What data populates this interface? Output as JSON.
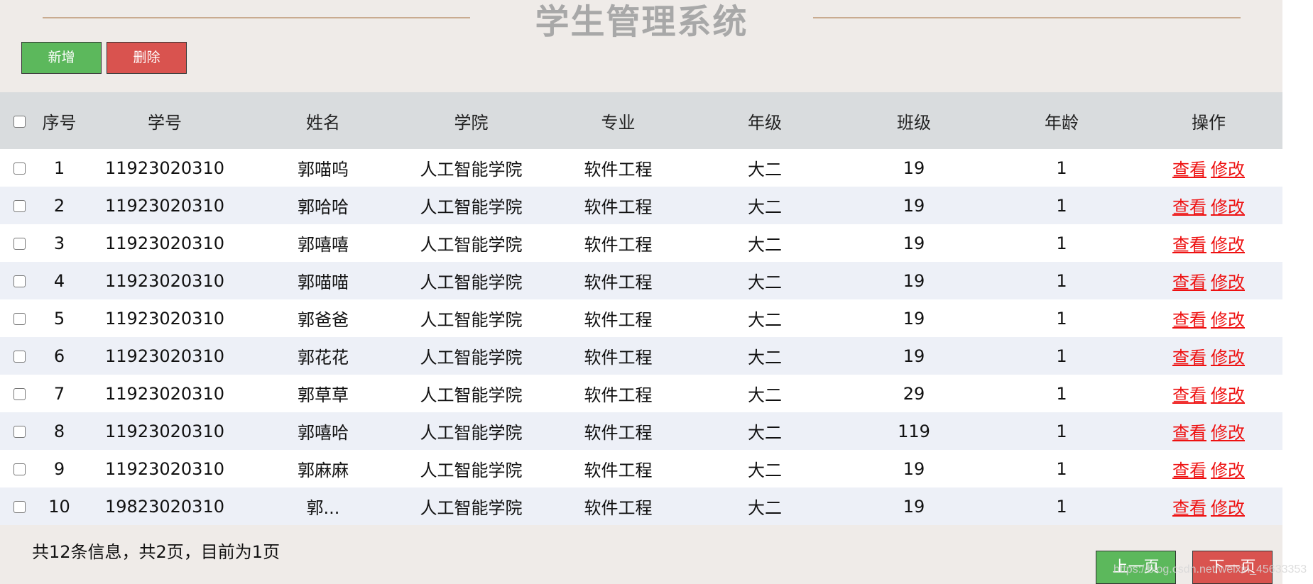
{
  "header": {
    "title": "学生管理系统"
  },
  "toolbar": {
    "add_label": "新增",
    "delete_label": "删除"
  },
  "table": {
    "columns": [
      "序号",
      "学号",
      "姓名",
      "学院",
      "专业",
      "年级",
      "班级",
      "年龄",
      "操作"
    ],
    "action_labels": {
      "view": "查看",
      "edit": "修改"
    },
    "rows": [
      {
        "no": "1",
        "student_id": "11923020310",
        "name": "郭喵呜",
        "college": "人工智能学院",
        "major": "软件工程",
        "grade": "大二",
        "class": "19",
        "age": "1"
      },
      {
        "no": "2",
        "student_id": "11923020310",
        "name": "郭哈哈",
        "college": "人工智能学院",
        "major": "软件工程",
        "grade": "大二",
        "class": "19",
        "age": "1"
      },
      {
        "no": "3",
        "student_id": "11923020310",
        "name": "郭嘻嘻",
        "college": "人工智能学院",
        "major": "软件工程",
        "grade": "大二",
        "class": "19",
        "age": "1"
      },
      {
        "no": "4",
        "student_id": "11923020310",
        "name": "郭喵喵",
        "college": "人工智能学院",
        "major": "软件工程",
        "grade": "大二",
        "class": "19",
        "age": "1"
      },
      {
        "no": "5",
        "student_id": "11923020310",
        "name": "郭爸爸",
        "college": "人工智能学院",
        "major": "软件工程",
        "grade": "大二",
        "class": "19",
        "age": "1"
      },
      {
        "no": "6",
        "student_id": "11923020310",
        "name": "郭花花",
        "college": "人工智能学院",
        "major": "软件工程",
        "grade": "大二",
        "class": "19",
        "age": "1"
      },
      {
        "no": "7",
        "student_id": "11923020310",
        "name": "郭草草",
        "college": "人工智能学院",
        "major": "软件工程",
        "grade": "大二",
        "class": "29",
        "age": "1"
      },
      {
        "no": "8",
        "student_id": "11923020310",
        "name": "郭嘻哈",
        "college": "人工智能学院",
        "major": "软件工程",
        "grade": "大二",
        "class": "119",
        "age": "1"
      },
      {
        "no": "9",
        "student_id": "11923020310",
        "name": "郭麻麻",
        "college": "人工智能学院",
        "major": "软件工程",
        "grade": "大二",
        "class": "19",
        "age": "1"
      },
      {
        "no": "10",
        "student_id": "19823020310",
        "name": "郭...",
        "college": "人工智能学院",
        "major": "软件工程",
        "grade": "大二",
        "class": "19",
        "age": "1"
      }
    ]
  },
  "footer": {
    "page_info": "共12条信息，共2页，目前为1页",
    "prev_label": "上一页",
    "next_label": "下一页",
    "watermark": "https://blog.csdn.net/weixin_45633353"
  },
  "colors": {
    "background": "#efebe8",
    "title": "#a8a8a8",
    "title_line": "#c9ab90",
    "header_row": "#d9dcde",
    "even_row": "#edf0f7",
    "button_green": "#5cb85c",
    "button_red": "#d9534f",
    "link_red": "#ee1111"
  }
}
